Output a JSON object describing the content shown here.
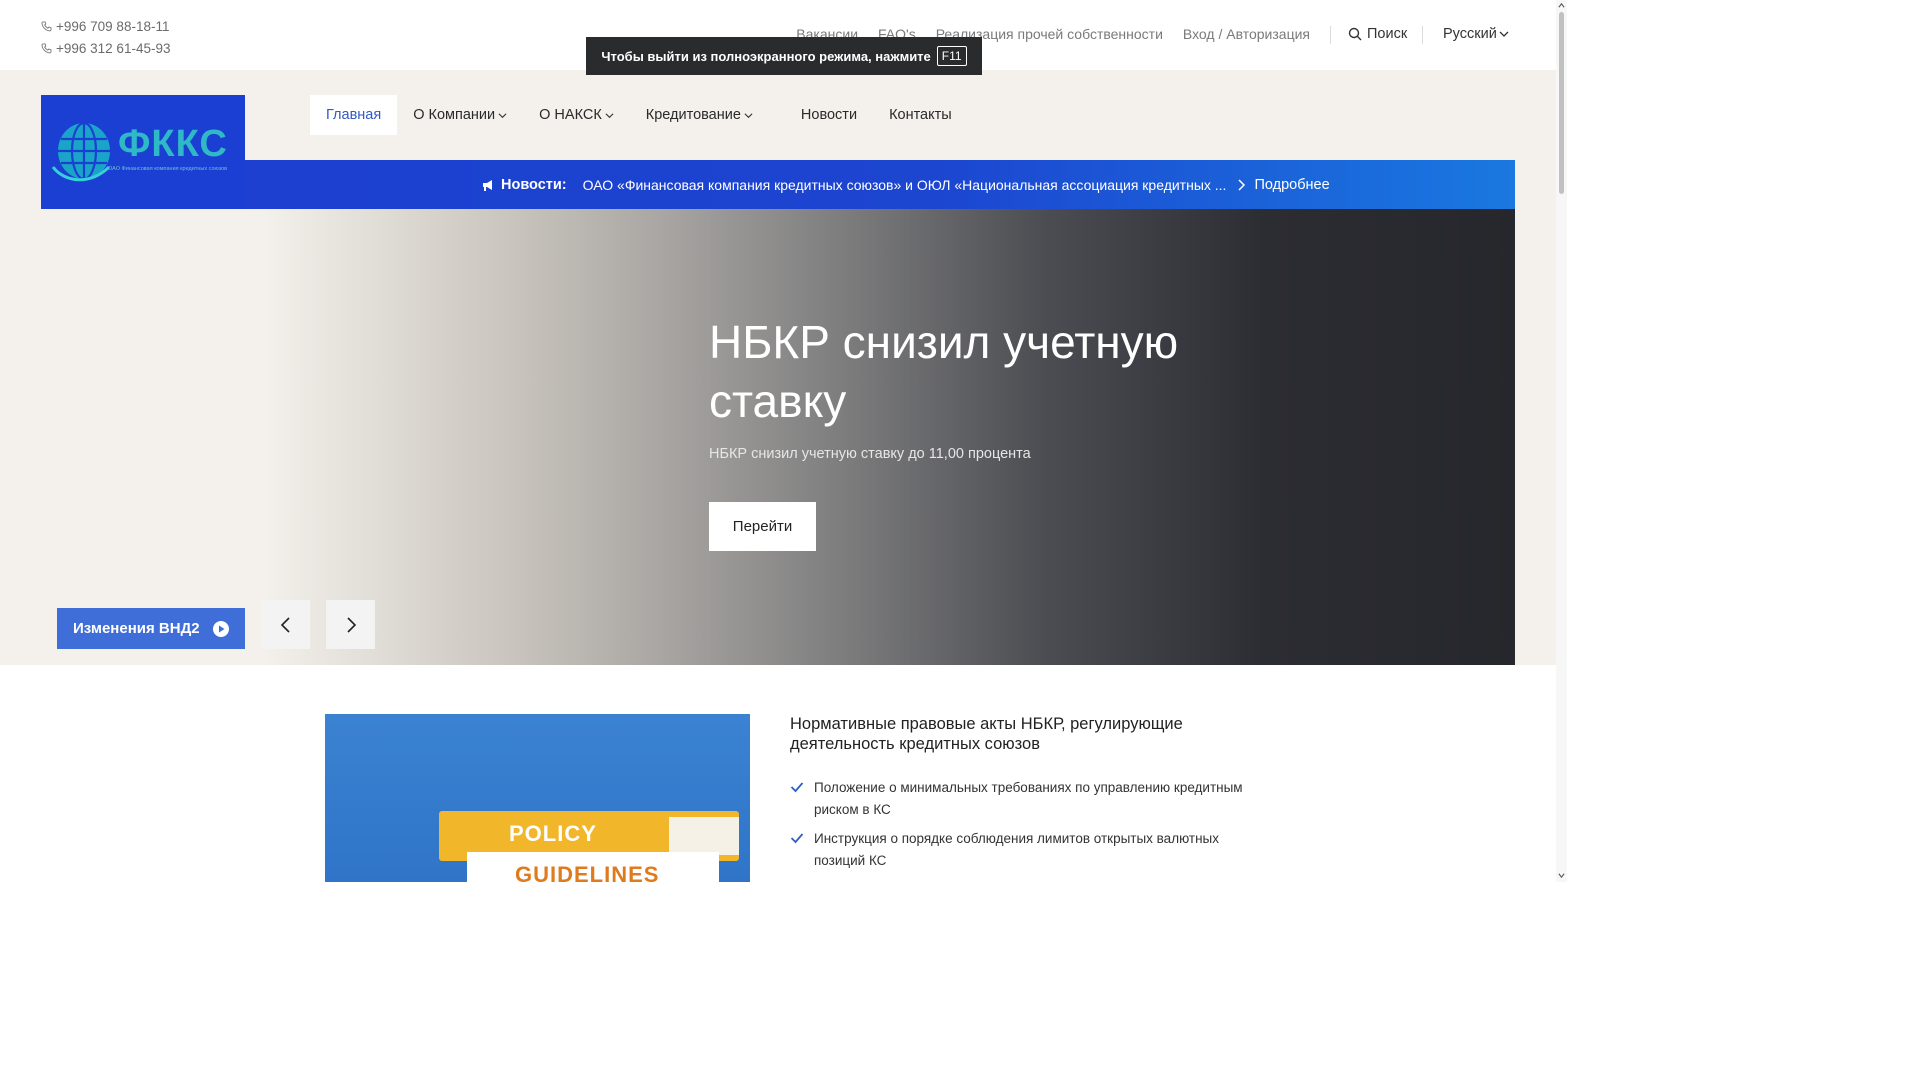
{
  "header": {
    "phones": [
      "+996 709 88-18-11",
      "+996 312 61-45-93"
    ],
    "links": [
      "Вакансии",
      "FAQ's",
      "Реализация прочей собственности",
      "Вход / Авторизация"
    ],
    "search_label": "Поиск",
    "language": "Русский"
  },
  "fullscreen_toast": {
    "message": "Чтобы выйти из полноэкранного режима, нажмите",
    "key": "F11"
  },
  "logo": {
    "text": "ФККС",
    "subtext": "ОАО Финансовая компания кредитных союзов"
  },
  "nav": {
    "items": [
      "Главная",
      "О Компании",
      "О НАКСК",
      "Кредитование",
      "Новости",
      "Контакты"
    ],
    "active_index": 0
  },
  "newsbar": {
    "label": "Новости:",
    "text": "ОАО «Финансовая компания кредитных союзов» и ОЮЛ «Национальная ассоциация кредитных ...",
    "more": "Подробнее"
  },
  "hero": {
    "title": "НБКР снизил учетную ставку",
    "subtitle": "НБКР снизил учетную ставку до 11,00 процента",
    "button": "Перейти",
    "vnd_button": "Изменения ВНД2"
  },
  "acts": {
    "image_labels": [
      "POLICY",
      "GUIDELINES"
    ],
    "title": "Нормативные правовые акты НБКР, регулирующие деятельность кредитных союзов",
    "items": [
      "Положение о минимальных требованиях по управлению кредитным риском в КС",
      "Инструкция о порядке соблюдения лимитов открытых валютных позиций КС"
    ]
  },
  "colors": {
    "brand_blue": "#1c3fd3",
    "accent_blue": "#3f6ed8",
    "beige": "#f4f1ec",
    "check_blue": "#2f5fc4"
  }
}
